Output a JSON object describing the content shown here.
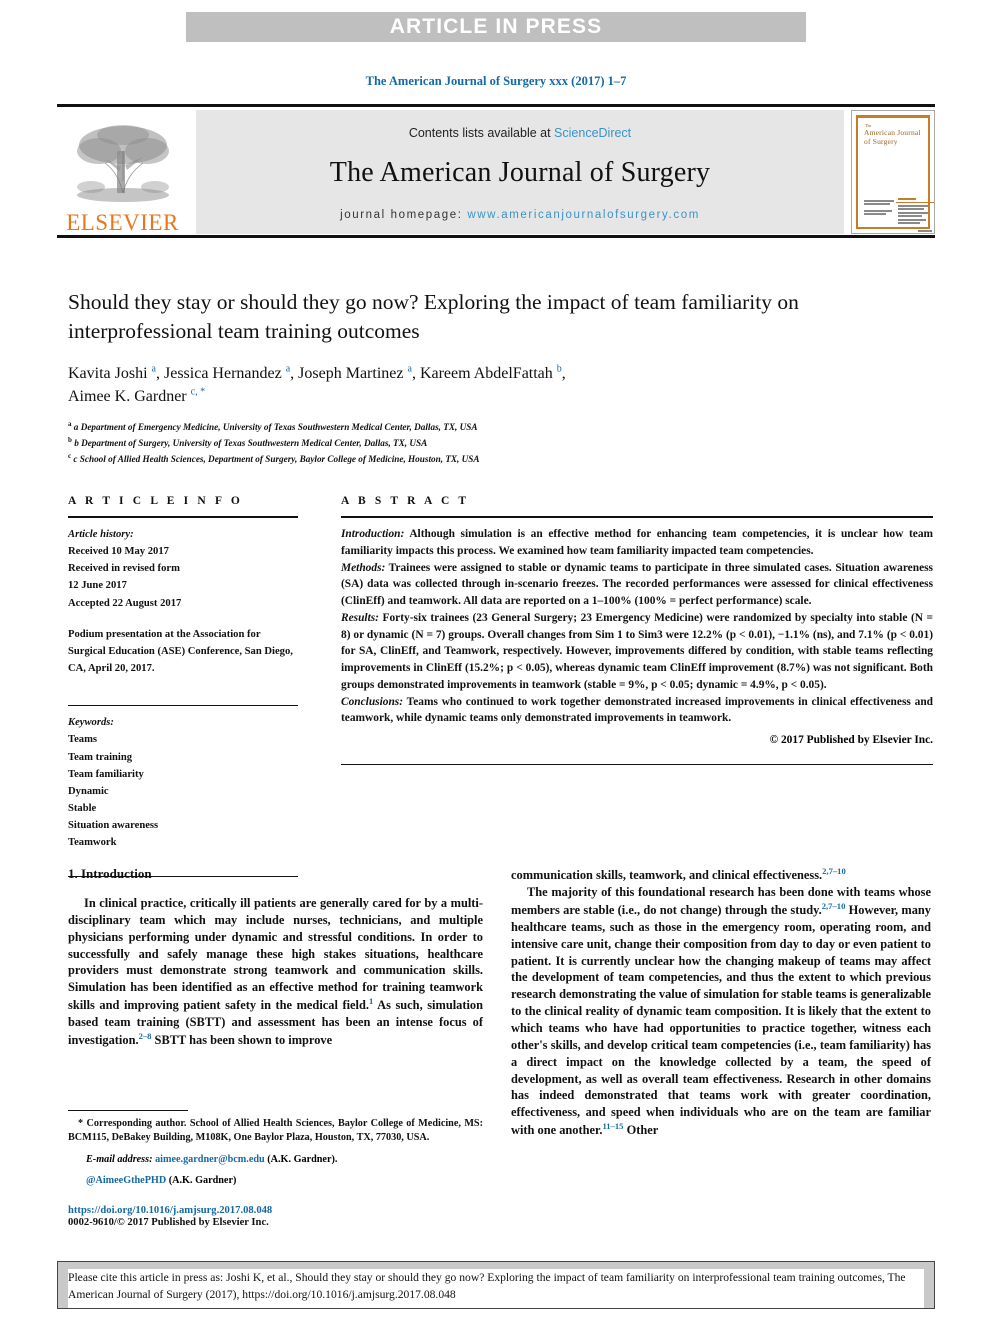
{
  "banner": {
    "text": "ARTICLE IN PRESS"
  },
  "running_head": "The American Journal of Surgery xxx (2017) 1–7",
  "masthead": {
    "publisher": "ELSEVIER",
    "contents_prefix": "Contents lists available at ",
    "contents_link": "ScienceDirect",
    "journal_title": "The American Journal of Surgery",
    "homepage_label": "journal homepage: ",
    "homepage_url": "www.americanjournalofsurgery.com",
    "cover_title_small": "The",
    "cover_title": "American Journal of Surgery",
    "accent_color": "#3a93c8",
    "elsevier_orange": "#e8761b"
  },
  "article": {
    "title": "Should they stay or should they go now? Exploring the impact of team familiarity on interprofessional team training outcomes",
    "authors_line1": "Kavita Joshi a, Jessica Hernandez a, Joseph Martinez a, Kareem AbdelFattah b,",
    "authors_line2": "Aimee K. Gardner c, *",
    "affiliations": [
      "a Department of Emergency Medicine, University of Texas Southwestern Medical Center, Dallas, TX, USA",
      "b Department of Surgery, University of Texas Southwestern Medical Center, Dallas, TX, USA",
      "c School of Allied Health Sciences, Department of Surgery, Baylor College of Medicine, Houston, TX, USA"
    ]
  },
  "article_info": {
    "heading": "A R T I C L E  I N F O",
    "history_label": "Article history:",
    "history": [
      "Received 10 May 2017",
      "Received in revised form",
      "12 June 2017",
      "Accepted 22 August 2017"
    ],
    "presentation": "Podium presentation at the Association for Surgical Education (ASE) Conference, San Diego, CA, April 20, 2017.",
    "keywords_label": "Keywords:",
    "keywords": [
      "Teams",
      "Team training",
      "Team familiarity",
      "Dynamic",
      "Stable",
      "Situation awareness",
      "Teamwork"
    ]
  },
  "abstract": {
    "heading": "A B S T R A C T",
    "sections": [
      {
        "label": "Introduction:",
        "text": " Although simulation is an effective method for enhancing team competencies, it is unclear how team familiarity impacts this process. We examined how team familiarity impacted team competencies."
      },
      {
        "label": "Methods:",
        "text": " Trainees were assigned to stable or dynamic teams to participate in three simulated cases. Situation awareness (SA) data was collected through in-scenario freezes. The recorded performances were assessed for clinical effectiveness (ClinEff) and teamwork. All data are reported on a 1–100% (100% = perfect performance) scale."
      },
      {
        "label": "Results:",
        "text": " Forty-six trainees (23 General Surgery; 23 Emergency Medicine) were randomized by specialty into stable (N = 8) or dynamic (N = 7) groups. Overall changes from Sim 1 to Sim3 were 12.2% (p < 0.01), −1.1% (ns), and 7.1% (p < 0.01) for SA, ClinEff, and Teamwork, respectively. However, improvements differed by condition, with stable teams reflecting improvements in ClinEff (15.2%; p < 0.05), whereas dynamic team ClinEff improvement (8.7%) was not significant. Both groups demonstrated improvements in teamwork (stable = 9%, p < 0.05; dynamic = 4.9%, p < 0.05)."
      },
      {
        "label": "Conclusions:",
        "text": " Teams who continued to work together demonstrated increased improvements in clinical effectiveness and teamwork, while dynamic teams only demonstrated improvements in teamwork."
      }
    ],
    "copyright": "© 2017 Published by Elsevier Inc."
  },
  "body": {
    "section_heading": "1. Introduction",
    "left_paragraph": "In clinical practice, critically ill patients are generally cared for by a multi-disciplinary team which may include nurses, technicians, and multiple physicians performing under dynamic and stressful conditions. In order to successfully and safely manage these high stakes situations, healthcare providers must demonstrate strong teamwork and communication skills. Simulation has been identified as an effective method for training teamwork skills and improving patient safety in the medical field.",
    "left_ref_1": "1",
    "left_paragraph_cont": " As such, simulation based team training (SBTT) and assessment has been an intense focus of investigation.",
    "left_ref_2": "2–8",
    "left_paragraph_end": " SBTT has been shown to improve",
    "right_lead": "communication skills, teamwork, and clinical effectiveness.",
    "right_ref_1": "2,7–10",
    "right_paragraph_a": "The majority of this foundational research has been done with teams whose members are stable (i.e., do not change) through the study.",
    "right_ref_2": "2,7–10",
    "right_paragraph_b": " However, many healthcare teams, such as those in the emergency room, operating room, and intensive care unit, change their composition from day to day or even patient to patient. It is currently unclear how the changing makeup of teams may affect the development of team competencies, and thus the extent to which previous research demonstrating the value of simulation for stable teams is generalizable to the clinical reality of dynamic team composition. It is likely that the extent to which teams who have had opportunities to practice together, witness each other's skills, and develop critical team competencies (i.e., team familiarity) has a direct impact on the knowledge collected by a team, the speed of development, as well as overall team effectiveness. Research in other domains has indeed demonstrated that teams work with greater coordination, effectiveness, and speed when individuals who are on the team are familiar with one another.",
    "right_ref_3": "11–15",
    "right_paragraph_end": " Other"
  },
  "footnote": {
    "corresponding": "* Corresponding author. School of Allied Health Sciences, Baylor College of Medicine, MS: BCM115, DeBakey Building, M108K, One Baylor Plaza, Houston, TX, 77030, USA.",
    "email_label": "E-mail address:",
    "email": "aimee.gardner@bcm.edu",
    "email_attrib": " (A.K. Gardner).",
    "twitter": "@AimeeGthePHD",
    "twitter_attrib": " (A.K. Gardner)",
    "doi": "https://doi.org/10.1016/j.amjsurg.2017.08.048",
    "issn_prefix": "0002-9610/",
    "issn_rest": "© 2017 Published by Elsevier Inc."
  },
  "citation_box": {
    "text": "Please cite this article in press as: Joshi K, et al., Should they stay or should they go now? Exploring the impact of team familiarity on interprofessional team training outcomes, The American Journal of Surgery (2017), https://doi.org/10.1016/j.amjsurg.2017.08.048"
  }
}
